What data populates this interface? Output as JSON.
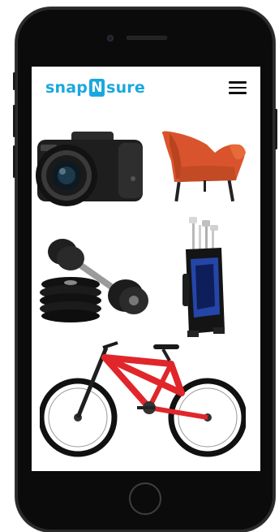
{
  "app": {
    "logo_left": "snap",
    "logo_mid": "N",
    "logo_right": "sure",
    "brand_color": "#1aa7e0"
  },
  "header": {
    "menu_icon": "hamburger-menu-icon"
  },
  "products": [
    {
      "name": "camera",
      "icon": "camera-image"
    },
    {
      "name": "armchair",
      "icon": "armchair-image"
    },
    {
      "name": "dumbbells",
      "icon": "dumbbells-image"
    },
    {
      "name": "golf-bag",
      "icon": "golf-bag-image"
    },
    {
      "name": "bicycle",
      "icon": "bicycle-image"
    }
  ],
  "colors": {
    "phone_body": "#0b0b0b",
    "bike_frame": "#e0262a",
    "chair": "#d9542c",
    "golf_bag": "#2446a8"
  }
}
